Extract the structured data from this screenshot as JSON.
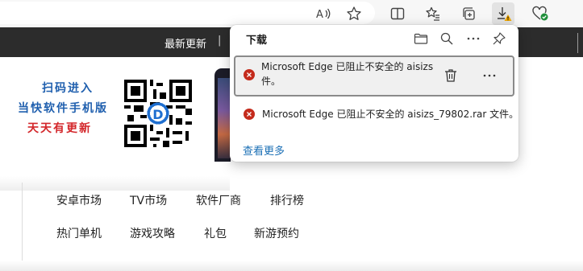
{
  "toolbar": {
    "address_bar_icons": [
      "read-aloud-icon",
      "favorite-star-icon"
    ],
    "buttons": [
      "split-screen-icon",
      "favorites-icon",
      "collections-icon",
      "downloads-icon",
      "browser-essentials-icon"
    ],
    "downloads_warning_color": "#f2a900"
  },
  "site": {
    "nav_item": "最新更新",
    "nav_separator": "|",
    "promo_line1": "扫码进入",
    "promo_line2": "当快软件手机版",
    "promo_line3": "天天有更新",
    "categories_row1": [
      "安卓市场",
      "TV市场",
      "软件厂商",
      "排行榜"
    ],
    "categories_row2": [
      "热门单机",
      "游戏攻略",
      "礼包",
      "新游预约"
    ]
  },
  "downloads": {
    "title": "下载",
    "header_icons": [
      "open-folder-icon",
      "search-icon",
      "more-options-icon",
      "pin-icon"
    ],
    "items": [
      {
        "line1": "Microsoft Edge 已阻止不安全的 aisizs",
        "line2": "件。",
        "status": "blocked"
      },
      {
        "text": "Microsoft Edge 已阻止不安全的 aisizs_79802.rar 文件。",
        "status": "blocked"
      }
    ],
    "see_more": "查看更多"
  },
  "colors": {
    "error_red": "#c42b1c",
    "link_blue": "#1a6fb5",
    "nav_bar": "#2c2c2c",
    "promo_blue": "#1f5fae",
    "promo_red": "#d3262a"
  }
}
